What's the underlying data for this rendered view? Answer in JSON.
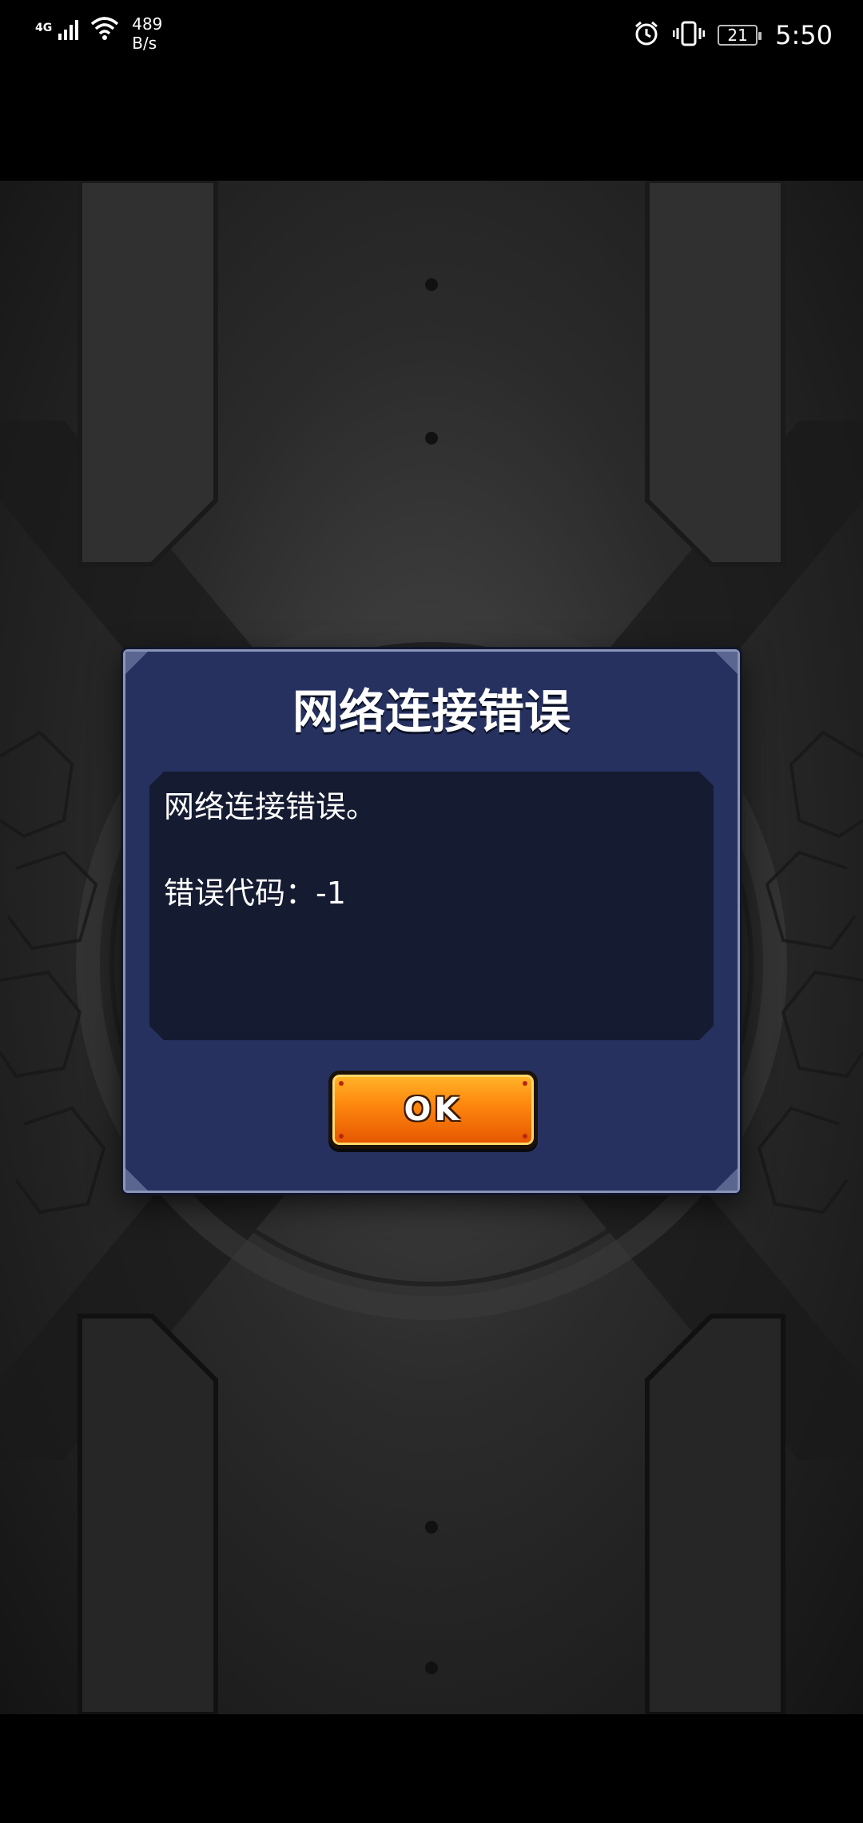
{
  "status_bar": {
    "network_type": "4G",
    "speed_value": "489",
    "speed_unit": "B/s",
    "battery_level": "21",
    "time": "5:50"
  },
  "dialog": {
    "title": "网络连接错误",
    "message": "网络连接错误。",
    "error_code_line": "错误代码：-1",
    "ok_label": "OK"
  },
  "colors": {
    "dialog_background": "#263160",
    "message_panel": "#151b30",
    "ok_button": "#ff8a10"
  }
}
